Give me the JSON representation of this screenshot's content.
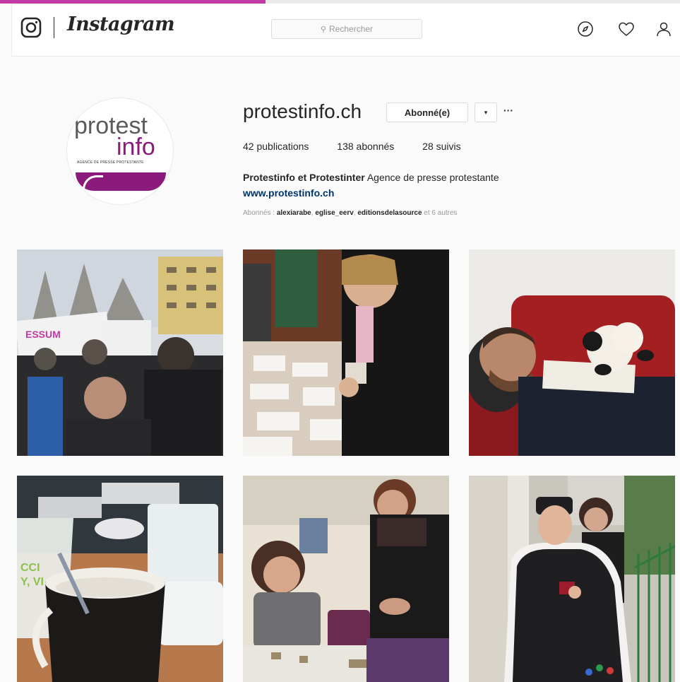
{
  "app": {
    "wordmark": "Instagram",
    "progress": 0.39
  },
  "search": {
    "placeholder": "Rechercher"
  },
  "icons": {
    "logo": "instagram-glyph-icon",
    "explore": "compass-icon",
    "activity": "heart-icon",
    "profile": "person-icon"
  },
  "profile": {
    "username": "protestinfo.ch",
    "follow_label": "Abonné(e)",
    "dropdown_label": "▾",
    "more_label": "···",
    "stats": {
      "posts": "42",
      "posts_label": "publications",
      "followers": "138",
      "followers_label": "abonnés",
      "following": "28",
      "following_label": "suivis"
    },
    "bio_name": "Protestinfo et Protestinter",
    "bio_text": " Agence de presse protestante",
    "website": "www.protestinfo.ch",
    "followed_by_prefix": "Abonnés : ",
    "followed_by": [
      "alexiarabe",
      "eglise_eerv",
      "editionsdelasource"
    ],
    "followed_by_suffix": " et 6 autres",
    "avatar": {
      "word1": "protest",
      "word2": "info",
      "tagline": "AGENCE DE PRESSE PROTESTANTE",
      "brand_color": "#8b1a7d"
    }
  },
  "posts": [
    {
      "alt": "Manifestation dans la rue"
    },
    {
      "alt": "Table de travail avec papiers"
    },
    {
      "alt": "Homme endormi sur un canapé rouge avec un mouton en peluche"
    },
    {
      "alt": "Tasses et ordinateur"
    },
    {
      "alt": "Deux femmes penchées sur une table"
    },
    {
      "alt": "Femme posant avec une silhouette en carton de Luther"
    }
  ]
}
